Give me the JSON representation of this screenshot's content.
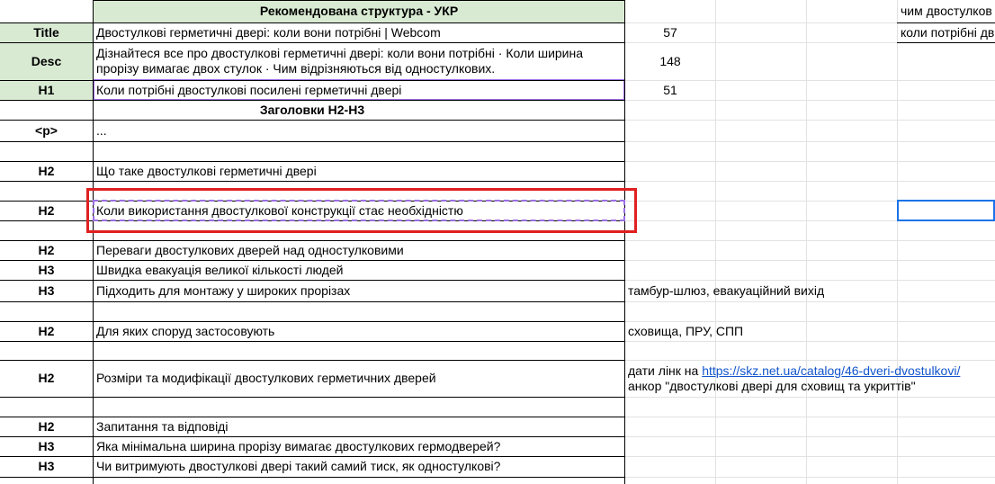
{
  "header": {
    "title": "Рекомендована структура - УКР",
    "h2h3_title": "Заголовки H2-H3"
  },
  "meta": {
    "title_label": "Title",
    "title_text": "Двостулкові герметичні двері: коли вони потрібні | Webcom",
    "title_count": "57",
    "desc_label": "Desc",
    "desc_text": "Дізнайтеся все про двостулкові герметичні двері: коли вони потрібні · Коли ширина прорізу вимагає двох стулок · Чим відрізняються від одностулкових.",
    "desc_count": "148",
    "h1_label": "H1",
    "h1_text": "Коли потрібні двостулкові посилені герметичні двері",
    "h1_count": "51"
  },
  "right_cut": {
    "row1": "чим двостулков",
    "row2": "коли потрібні дв"
  },
  "rows": [
    {
      "tag": "<p>",
      "text": "..."
    },
    {
      "tag": "",
      "text": ""
    },
    {
      "tag": "H2",
      "text": "Що таке двостулкові герметичні двері"
    },
    {
      "tag": "",
      "text": ""
    },
    {
      "tag": "H2",
      "text": "Коли використання двостулкової конструкції стає необхідністю"
    },
    {
      "tag": "",
      "text": ""
    },
    {
      "tag": "H2",
      "text": "Переваги двостулкових дверей над одностулковими"
    },
    {
      "tag": "H3",
      "text": "Швидка евакуація великої кількості людей"
    },
    {
      "tag": "H3",
      "text": "Підходить для монтажу у широких прорізах",
      "note": "тамбур-шлюз, евакуаційний вихід"
    },
    {
      "tag": "",
      "text": ""
    },
    {
      "tag": "H2",
      "text": "Для яких споруд застосовують",
      "note": "сховища, ПРУ, СПП"
    },
    {
      "tag": "",
      "text": ""
    },
    {
      "tag": "H2",
      "text": "Розміри та модифікації двостулкових герметичних дверей"
    },
    {
      "tag": "",
      "text": ""
    },
    {
      "tag": "H2",
      "text": "Запитання та відповіді"
    },
    {
      "tag": "H3",
      "text": "Яка мінімальна ширина прорізу вимагає двостулкових гермодверей?"
    },
    {
      "tag": "H3",
      "text": "Чи витримують двостулкові двері такий самий тиск, як одностулкові?"
    }
  ],
  "link_note": {
    "prefix": "дати лінк на ",
    "url": "https://skz.net.ua/catalog/46-dveri-dvostulkovi/",
    "anchor_line": "анкор \"двостулкові двері для сховищ та укриттів\""
  }
}
